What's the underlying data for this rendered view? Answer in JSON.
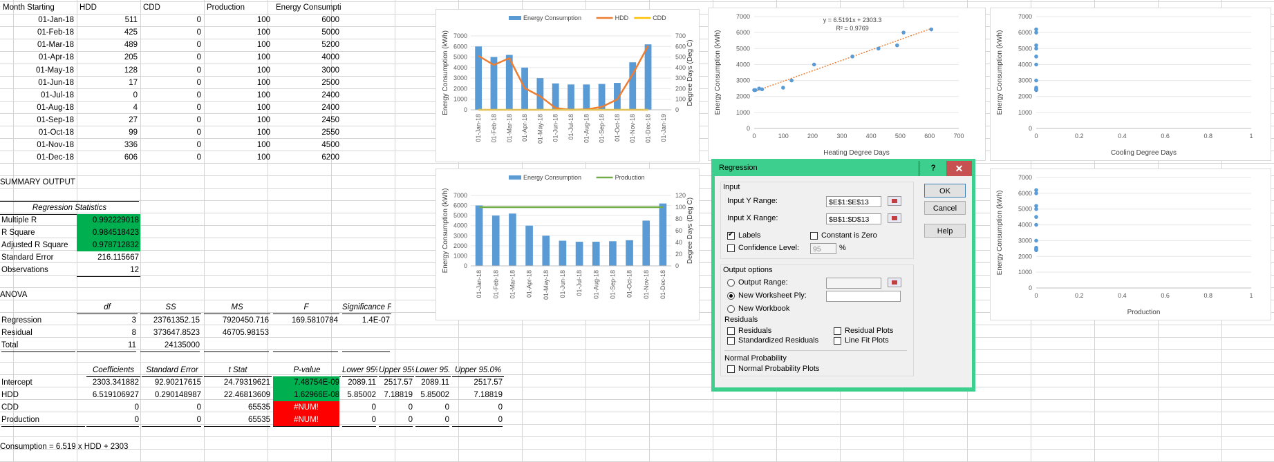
{
  "colors": {
    "bar": "#5b9bd5",
    "hdd": "#ed7d31",
    "cdd": "#ffc000",
    "production": "#70ad47",
    "dot": "#5b9bd5",
    "trend": "#ed7d31",
    "dialog_frame": "#3ccf8e",
    "positive": "#00b050",
    "error": "#ff0000"
  },
  "sheet": {
    "headers": [
      "Month Starting",
      "HDD",
      "CDD",
      "Production",
      "Energy Consumption"
    ],
    "rows": [
      [
        "01-Jan-18",
        "511",
        "0",
        "100",
        "6000"
      ],
      [
        "01-Feb-18",
        "425",
        "0",
        "100",
        "5000"
      ],
      [
        "01-Mar-18",
        "489",
        "0",
        "100",
        "5200"
      ],
      [
        "01-Apr-18",
        "205",
        "0",
        "100",
        "4000"
      ],
      [
        "01-May-18",
        "128",
        "0",
        "100",
        "3000"
      ],
      [
        "01-Jun-18",
        "17",
        "0",
        "100",
        "2500"
      ],
      [
        "01-Jul-18",
        "0",
        "0",
        "100",
        "2400"
      ],
      [
        "01-Aug-18",
        "4",
        "0",
        "100",
        "2400"
      ],
      [
        "01-Sep-18",
        "27",
        "0",
        "100",
        "2450"
      ],
      [
        "01-Oct-18",
        "99",
        "0",
        "100",
        "2550"
      ],
      [
        "01-Nov-18",
        "336",
        "0",
        "100",
        "4500"
      ],
      [
        "01-Dec-18",
        "606",
        "0",
        "100",
        "6200"
      ]
    ],
    "summary_title": "SUMMARY OUTPUT",
    "reg_stats_title": "Regression Statistics",
    "reg_stats": [
      {
        "label": "Multiple R",
        "value": "0.992229018",
        "hl": true
      },
      {
        "label": "R Square",
        "value": "0.984518423",
        "hl": true
      },
      {
        "label": "Adjusted R Square",
        "value": "0.978712832",
        "hl": true
      },
      {
        "label": "Standard Error",
        "value": "216.115667",
        "hl": false
      },
      {
        "label": "Observations",
        "value": "12",
        "hl": false
      }
    ],
    "anova_title": "ANOVA",
    "anova_headers": [
      "",
      "df",
      "SS",
      "MS",
      "F",
      "Significance F"
    ],
    "anova_rows": [
      [
        "Regression",
        "3",
        "23761352.15",
        "7920450.716",
        "169.5810784",
        "1.4E-07"
      ],
      [
        "Residual",
        "8",
        "373647.8523",
        "46705.98153",
        "",
        ""
      ],
      [
        "Total",
        "11",
        "24135000",
        "",
        "",
        ""
      ]
    ],
    "coef_headers": [
      "",
      "Coefficients",
      "Standard Error",
      "t Stat",
      "P-value",
      "Lower 95%",
      "Upper 95%",
      "Lower 95.0%",
      "Upper 95.0%"
    ],
    "coef_rows": [
      [
        "Intercept",
        "2303.341882",
        "92.90217615",
        "24.79319621",
        "7.48754E-09",
        "2089.11",
        "2517.57",
        "2089.11",
        "2517.57"
      ],
      [
        "HDD",
        "6.519106927",
        "0.290148987",
        "22.46813609",
        "1.62966E-08",
        "5.85002",
        "7.18819",
        "5.85002",
        "7.18819"
      ],
      [
        "CDD",
        "0",
        "0",
        "65535",
        "#NUM!",
        "0",
        "0",
        "0",
        "0"
      ],
      [
        "Production",
        "0",
        "0",
        "65535",
        "#NUM!",
        "0",
        "0",
        "0",
        "0"
      ]
    ],
    "formula": "Consumption = 6.519 x HDD + 2303"
  },
  "chart_data": [
    {
      "type": "bar",
      "chart": "energy-hdd-cdd",
      "categories": [
        "01-Jan-18",
        "01-Feb-18",
        "01-Mar-18",
        "01-Apr-18",
        "01-May-18",
        "01-Jun-18",
        "01-Jul-18",
        "01-Aug-18",
        "01-Sep-18",
        "01-Oct-18",
        "01-Nov-18",
        "01-Dec-18",
        "01-Jan-19"
      ],
      "series": [
        {
          "name": "Energy Consumption",
          "kind": "bar",
          "axis": "left",
          "values": [
            6000,
            5000,
            5200,
            4000,
            3000,
            2500,
            2400,
            2400,
            2450,
            2550,
            4500,
            6200
          ]
        },
        {
          "name": "HDD",
          "kind": "line",
          "axis": "right",
          "values": [
            511,
            425,
            489,
            205,
            128,
            17,
            0,
            4,
            27,
            99,
            336,
            606
          ]
        },
        {
          "name": "CDD",
          "kind": "line",
          "axis": "right",
          "values": [
            0,
            0,
            0,
            0,
            0,
            0,
            0,
            0,
            0,
            0,
            0,
            0
          ]
        }
      ],
      "ylabel": "Energy Consumption (kWh)",
      "y2label": "Degree Days (Deg C)",
      "ylim": [
        0,
        7000
      ],
      "y2lim": [
        0,
        700
      ],
      "yticks": [
        "0",
        "1000",
        "2000",
        "3000",
        "4000",
        "5000",
        "6000",
        "7000"
      ],
      "y2ticks": [
        "0",
        "100",
        "200",
        "300",
        "400",
        "500",
        "600",
        "700"
      ],
      "legend": "top"
    },
    {
      "type": "scatter",
      "chart": "hdd-scatter",
      "x": [
        511,
        425,
        489,
        205,
        128,
        17,
        0,
        4,
        27,
        99,
        336,
        606
      ],
      "y": [
        6000,
        5000,
        5200,
        4000,
        3000,
        2500,
        2400,
        2400,
        2450,
        2550,
        4500,
        6200
      ],
      "trendline": {
        "slope": 6.5191,
        "intercept": 2303.3
      },
      "equation": "y = 6.5191x + 2303.3",
      "r2": "R² = 0.9769",
      "xlabel": "Heating Degree Days",
      "ylabel": "Energy Consumption (kWh)",
      "xlim": [
        0,
        700
      ],
      "ylim": [
        0,
        7000
      ],
      "xticks": [
        "0",
        "100",
        "200",
        "300",
        "400",
        "500",
        "600",
        "700"
      ],
      "yticks": [
        "0",
        "1000",
        "2000",
        "3000",
        "4000",
        "5000",
        "6000",
        "7000"
      ]
    },
    {
      "type": "scatter",
      "chart": "cdd-scatter",
      "x": [
        0,
        0,
        0,
        0,
        0,
        0,
        0,
        0,
        0,
        0,
        0,
        0
      ],
      "y": [
        6000,
        5000,
        5200,
        4000,
        3000,
        2500,
        2400,
        2400,
        2450,
        2550,
        4500,
        6200
      ],
      "xlabel": "Cooling Degree Days",
      "ylabel": "Energy Consumption (kWh)",
      "xlim": [
        0,
        1
      ],
      "ylim": [
        0,
        7000
      ],
      "xticks": [
        "0",
        "0.2",
        "0.4",
        "0.6",
        "0.8",
        "1"
      ],
      "yticks": [
        "0",
        "1000",
        "2000",
        "3000",
        "4000",
        "5000",
        "6000",
        "7000"
      ]
    },
    {
      "type": "bar",
      "chart": "energy-production",
      "categories": [
        "01-Jan-18",
        "01-Feb-18",
        "01-Mar-18",
        "01-Apr-18",
        "01-May-18",
        "01-Jun-18",
        "01-Jul-18",
        "01-Aug-18",
        "01-Sep-18",
        "01-Oct-18",
        "01-Nov-18",
        "01-Dec-18"
      ],
      "series": [
        {
          "name": "Energy Consumption",
          "kind": "bar",
          "axis": "left",
          "values": [
            6000,
            5000,
            5200,
            4000,
            3000,
            2500,
            2400,
            2400,
            2450,
            2550,
            4500,
            6200
          ]
        },
        {
          "name": "Production",
          "kind": "line",
          "axis": "right",
          "values": [
            100,
            100,
            100,
            100,
            100,
            100,
            100,
            100,
            100,
            100,
            100,
            100
          ]
        }
      ],
      "ylabel": "Energy Consumption (kWh)",
      "y2label": "Degree Days (Deg C)",
      "ylim": [
        0,
        7000
      ],
      "y2lim": [
        0,
        120
      ],
      "yticks": [
        "0",
        "1000",
        "2000",
        "3000",
        "4000",
        "5000",
        "6000",
        "7000"
      ],
      "y2ticks": [
        "0",
        "20",
        "40",
        "60",
        "80",
        "100",
        "120"
      ],
      "legend": "top"
    },
    {
      "type": "scatter",
      "chart": "production-scatter",
      "x": [
        0,
        0,
        0,
        0,
        0,
        0,
        0,
        0,
        0,
        0,
        0,
        0
      ],
      "y": [
        6000,
        5000,
        5200,
        4000,
        3000,
        2500,
        2400,
        2400,
        2450,
        2550,
        4500,
        6200
      ],
      "xlabel": "Production",
      "ylabel": "Energy Consumption (kWh)",
      "xlim": [
        0,
        1
      ],
      "ylim": [
        0,
        7000
      ],
      "xticks": [
        "0",
        "0.2",
        "0.4",
        "0.6",
        "0.8",
        "1"
      ],
      "yticks": [
        "0",
        "1000",
        "2000",
        "3000",
        "4000",
        "5000",
        "6000",
        "7000"
      ]
    }
  ],
  "dialog": {
    "title": "Regression",
    "help_glyph": "?",
    "close_glyph": "✕",
    "input_group": "Input",
    "input_y_label": "Input Y Range:",
    "input_y_value": "$E$1:$E$13",
    "input_x_label": "Input X Range:",
    "input_x_value": "$B$1:$D$13",
    "labels": "Labels",
    "constant_zero": "Constant is Zero",
    "confidence": "Confidence Level:",
    "confidence_value": "95",
    "percent": "%",
    "output_group": "Output options",
    "output_range": "Output Range:",
    "new_ply": "New Worksheet Ply:",
    "new_workbook": "New Workbook",
    "residuals_group": "Residuals",
    "residuals": "Residuals",
    "std_residuals": "Standardized Residuals",
    "residual_plots": "Residual Plots",
    "line_fit": "Line Fit Plots",
    "normal_group": "Normal Probability",
    "normal_plots": "Normal Probability Plots",
    "ok": "OK",
    "cancel": "Cancel",
    "help": "Help"
  }
}
